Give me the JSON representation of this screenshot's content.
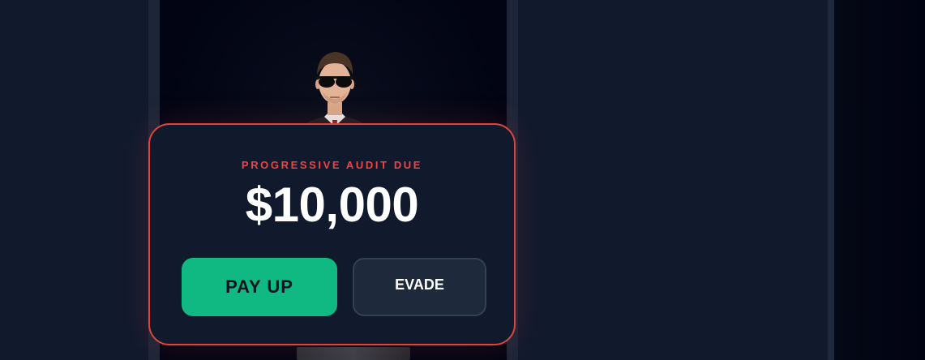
{
  "modal": {
    "title": "PROGRESSIVE AUDIT DUE",
    "amount": "$10,000",
    "pay_label": "PAY UP",
    "evade_label": "EVADE"
  },
  "colors": {
    "accent_red": "#ef4444",
    "pay_green": "#10b981",
    "panel_bg": "#111a2d"
  },
  "icons": {
    "character": "agent-in-sunglasses"
  }
}
